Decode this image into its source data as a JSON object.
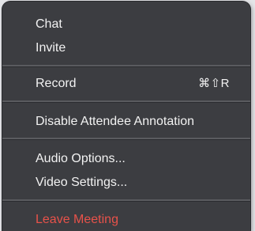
{
  "menu": {
    "items": [
      {
        "label": "Chat",
        "shortcut": ""
      },
      {
        "label": "Invite",
        "shortcut": ""
      },
      {
        "label": "Record",
        "shortcut": "⌘⇧R"
      },
      {
        "label": "Disable Attendee Annotation",
        "shortcut": ""
      },
      {
        "label": "Audio Options...",
        "shortcut": ""
      },
      {
        "label": "Video Settings...",
        "shortcut": ""
      },
      {
        "label": "Leave Meeting",
        "shortcut": ""
      }
    ],
    "danger_color": "#e8524a"
  }
}
